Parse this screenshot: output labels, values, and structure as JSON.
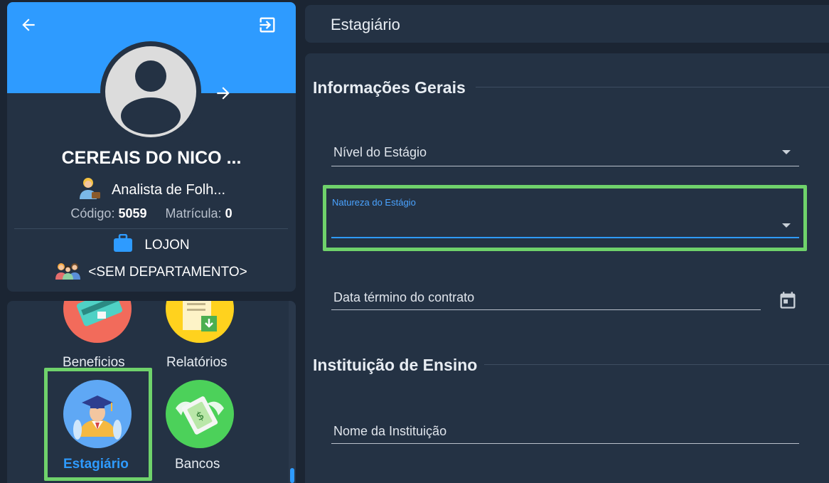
{
  "profile": {
    "company": "CEREAIS DO NICO ...",
    "role": "Analista de Folh...",
    "code_label": "Código:",
    "code_value": "5059",
    "registration_label": "Matrícula:",
    "registration_value": "0",
    "store": "LOJON",
    "department": "<SEM DEPARTAMENTO>"
  },
  "menu": {
    "items": [
      {
        "label": "Beneficios"
      },
      {
        "label": "Relatórios"
      },
      {
        "label": "Estagiário"
      },
      {
        "label": "Bancos"
      }
    ]
  },
  "header": {
    "title": "Estagiário"
  },
  "form": {
    "general_section": "Informações Gerais",
    "level_label": "Nível do Estágio",
    "nature_label": "Natureza do Estágio",
    "end_date_label": "Data término do contrato",
    "institution_section": "Instituição de Ensino",
    "institution_name_label": "Nome da Instituição"
  },
  "colors": {
    "banner": "#2e9bff",
    "panel": "#243244",
    "background": "#1b2533",
    "highlight": "#6fd26b",
    "active_text": "#2e9bff"
  }
}
